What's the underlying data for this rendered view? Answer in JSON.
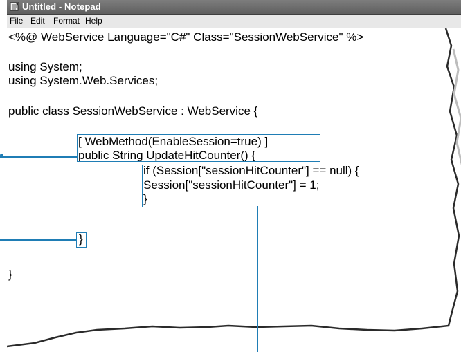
{
  "window": {
    "title": "Untitled - Notepad"
  },
  "menu": [
    "File",
    "Edit",
    "Format",
    "Help"
  ],
  "code": {
    "directive": "<%@ WebService Language=\"C#\" Class=\"SessionWebService\" %>",
    "using1": "using System;",
    "using2": "using System.Web.Services;",
    "classdecl": "public class SessionWebService : WebService {",
    "attribute": "[ WebMethod(EnableSession=true) ]",
    "method": "public String UpdateHitCounter() {",
    "if_line": "if (Session[\"sessionHitCounter\"] == null) {",
    "assign": "Session[\"sessionHitCounter\"] = 1;",
    "close_if": "}",
    "close_method": "}",
    "close_class": "}"
  },
  "colors": {
    "callout": "#1f7db5",
    "titlebar": "#6a6a6a"
  }
}
